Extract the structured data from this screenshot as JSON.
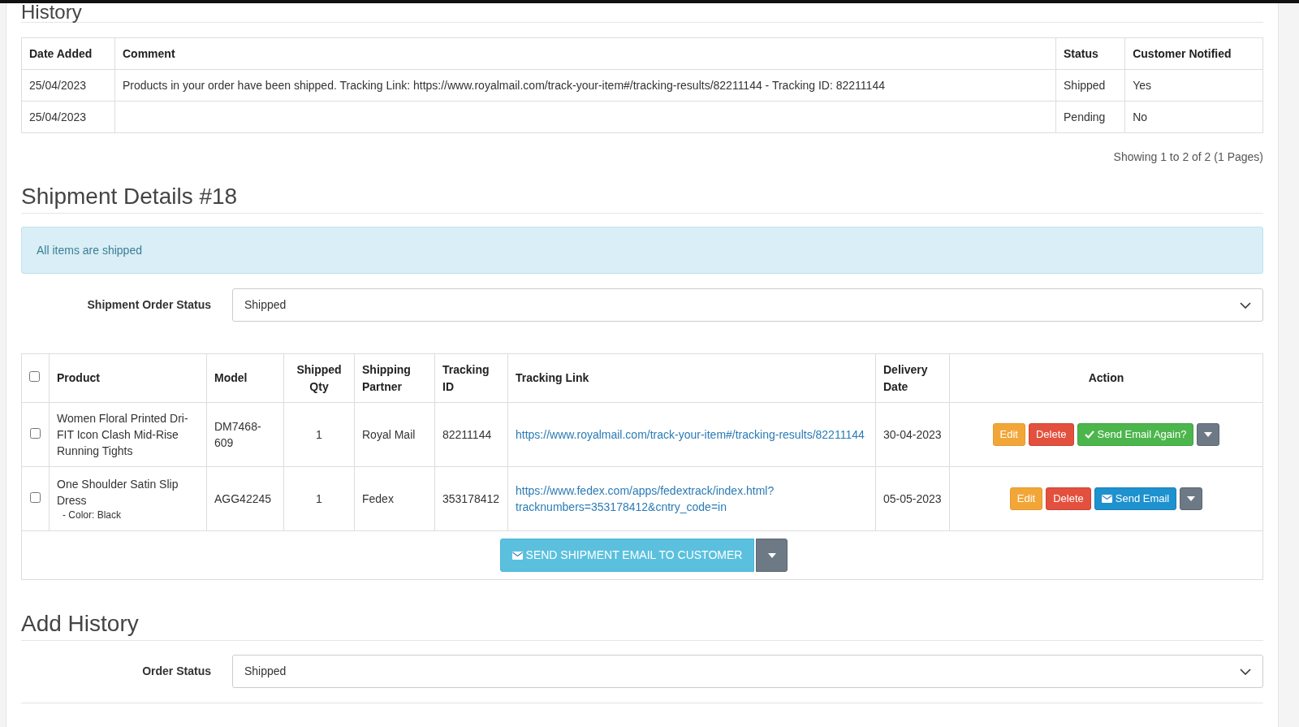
{
  "history": {
    "title": "History",
    "columns": [
      "Date Added",
      "Comment",
      "Status",
      "Customer Notified"
    ],
    "rows": [
      [
        "25/04/2023",
        "Products in your order have been shipped. Tracking Link: https://www.royalmail.com/track-your-item#/tracking-results/82211144 - Tracking ID: 82211144",
        "Shipped",
        "Yes"
      ],
      [
        "25/04/2023",
        "",
        "Pending",
        "No"
      ]
    ],
    "pagination": "Showing 1 to 2 of 2 (1 Pages)"
  },
  "shipment": {
    "title": "Shipment Details #18",
    "alert": "All items are shipped",
    "status_label": "Shipment Order Status",
    "status_value": "Shipped",
    "select_all_checked": false,
    "columns": [
      "Product",
      "Model",
      "Shipped Qty",
      "Shipping Partner",
      "Tracking ID",
      "Tracking Link",
      "Delivery Date",
      "Action"
    ],
    "rows": [
      {
        "checked": false,
        "product": "Women Floral Printed Dri-FIT Icon Clash Mid-Rise Running Tights",
        "option": "",
        "model": "DM7468-609",
        "qty": "1",
        "partner": "Royal Mail",
        "tracking_id": "82211144",
        "link": "https://www.royalmail.com/track-your-item#/tracking-results/82211144",
        "date": "30-04-2023",
        "actions": [
          {
            "kind": "edit",
            "label": "Edit"
          },
          {
            "kind": "delete",
            "label": "Delete"
          },
          {
            "kind": "resend",
            "label": "Send Email Again?"
          },
          {
            "kind": "caret"
          }
        ]
      },
      {
        "checked": false,
        "product": "One Shoulder Satin Slip Dress",
        "option": "- Color: Black",
        "model": "AGG42245",
        "qty": "1",
        "partner": "Fedex",
        "tracking_id": "353178412",
        "link": "https://www.fedex.com/apps/fedextrack/index.html?tracknumbers=353178412&cntry_code=in",
        "date": "05-05-2023",
        "actions": [
          {
            "kind": "edit",
            "label": "Edit"
          },
          {
            "kind": "delete",
            "label": "Delete"
          },
          {
            "kind": "send",
            "label": "Send Email"
          },
          {
            "kind": "caret"
          }
        ]
      }
    ],
    "send_button": "SEND SHIPMENT EMAIL TO CUSTOMER"
  },
  "add_history": {
    "title": "Add History",
    "status_label": "Order Status",
    "status_value": "Shipped"
  }
}
